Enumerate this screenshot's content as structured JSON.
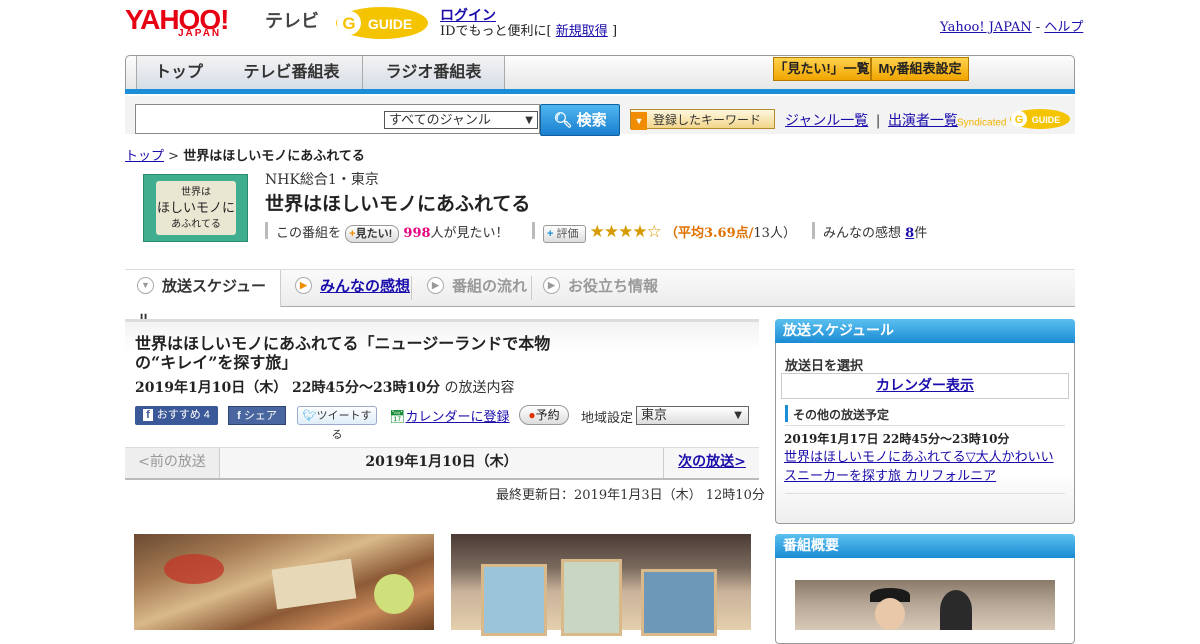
{
  "header": {
    "yahoo_logo": "YAHOO!",
    "yahoo_sub": "JAPAN",
    "tv_label": "テレビ",
    "gguide_logo": "G GUIDE",
    "login": "ログイン",
    "login_note_prefix": "IDでもっと便利に[",
    "signup": "新規取得",
    "login_note_suffix": "]",
    "yahoo_japan": "Yahoo! JAPAN",
    "dash": "-",
    "help": "ヘルプ"
  },
  "nav": {
    "tabs": [
      "トップ",
      "テレビ番組表",
      "ラジオ番組表"
    ],
    "mitai_list": "「見たい!」一覧",
    "my_schedule": "My番組表設定"
  },
  "search": {
    "genre": "すべてのジャンル",
    "button": "検索",
    "keyword_btn": "登録したキーワード",
    "genre_list": "ジャンル一覧",
    "divider": "|",
    "performer_list": "出演者一覧",
    "syndicated": "Syndicated"
  },
  "breadcrumb": {
    "top": "トップ",
    "sep": ">",
    "current": "世界はほしいモノにあふれてる"
  },
  "program": {
    "thumb_text_1": "世界は",
    "thumb_text_2": "ほしいモノに",
    "thumb_text_3": "あふれてる",
    "channel": "NHK総合1・東京",
    "title": "世界はほしいモノにあふれてる",
    "mitai_prefix": "この番組を",
    "mitai_btn": "見たい!",
    "mitai_count": "998",
    "mitai_suffix": "人が見たい！",
    "rate_btn": "評価",
    "stars": "★★★★☆",
    "avg_label": "（平均3.69点/",
    "rating_count": "13人）",
    "rating_avg": 3.69,
    "opinion_label": "みんなの感想",
    "opinion_count": "8",
    "opinion_suffix": "件"
  },
  "tabs": [
    "放送スケジュール",
    "みんなの感想",
    "番組の流れ",
    "お役立ち情報"
  ],
  "episode": {
    "title": "世界はほしいモノにあふれてる「ニュージーランドで本物の“キレイ”を探す旅」",
    "date": "2019年1月10日（木） 22時45分～23時10分",
    "date_suffix": "の放送内容",
    "recommend": "おすすめ",
    "recommend_count": "4",
    "share": "シェア",
    "tweet": "ツイートする",
    "calendar": "カレンダーに登録",
    "reserve": "予約",
    "region_label": "地域設定",
    "region": "東京"
  },
  "date_nav": {
    "prev": "<前の放送",
    "current": "2019年1月10日（木）",
    "next": "次の放送>"
  },
  "updated": "最終更新日：2019年1月3日（木） 12時10分",
  "sidebar": {
    "schedule_head": "放送スケジュール",
    "select_date": "放送日を選択",
    "calendar_show": "カレンダー表示",
    "other_head": "その他の放送予定",
    "other_date": "2019年1月17日 22時45分～23時10分",
    "other_title": "世界はほしいモノにあふれてる▽大人かわいいスニーカーを探す旅 カリフォルニア",
    "summary_head": "番組概要"
  },
  "colors": {
    "accent_blue": "#1a8fd8",
    "yahoo_red": "#e60012",
    "rating_orange": "#e07000",
    "pink": "#e4007f"
  }
}
